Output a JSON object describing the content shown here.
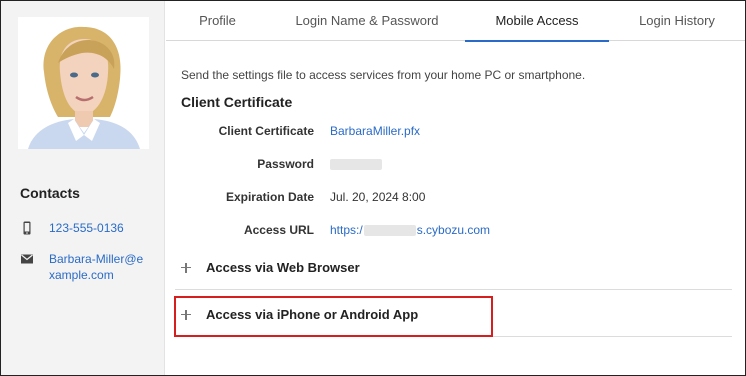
{
  "sidebar": {
    "contacts_title": "Contacts",
    "phone": "123-555-0136",
    "email": "Barbara-Miller@example.com",
    "phone_icon": "phone-icon",
    "email_icon": "mail-icon"
  },
  "tabs": [
    {
      "label": "Profile"
    },
    {
      "label": "Login Name & Password"
    },
    {
      "label": "Mobile Access",
      "active": true
    },
    {
      "label": "Login History"
    }
  ],
  "content": {
    "description": "Send the settings file to access services from your home PC or smartphone.",
    "client_certificate_title": "Client Certificate",
    "rows": {
      "certificate": {
        "label": "Client Certificate",
        "value": "BarbaraMiller.pfx"
      },
      "password": {
        "label": "Password"
      },
      "expiration": {
        "label": "Expiration Date",
        "value": "Jul. 20, 2024 8:00"
      },
      "access_url": {
        "label": "Access URL",
        "value_prefix": "https:/",
        "value_suffix": "s.cybozu.com"
      }
    },
    "accordions": [
      {
        "label": "Access via Web Browser"
      },
      {
        "label": "Access via iPhone or Android App"
      }
    ]
  },
  "colors": {
    "accent": "#2a6bc7",
    "highlight": "#d61e1e"
  }
}
